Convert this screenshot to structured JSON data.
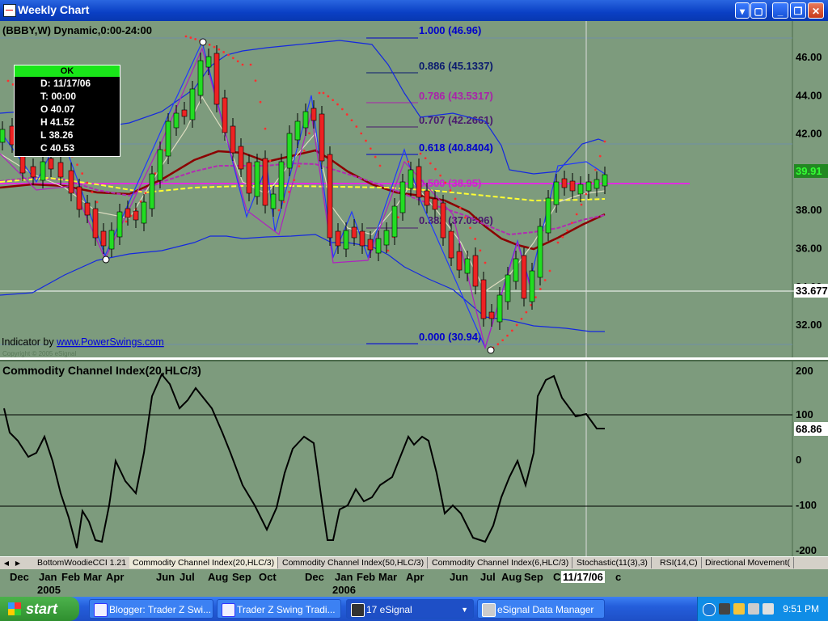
{
  "window": {
    "title": "Weekly Chart"
  },
  "chart": {
    "header": "(BBBY,W) Dynamic,0:00-24:00",
    "indicator_credit_prefix": "Indicator by ",
    "indicator_credit_link": "www.PowerSwings.com",
    "copyright": "Copyright © 2005 eSignal",
    "crosshair_price": "33.677",
    "last_price": "39.91",
    "price_ticks": [
      "46.00",
      "44.00",
      "42.00",
      "40.00",
      "38.00",
      "36.00",
      "34.00",
      "32.00"
    ],
    "fib_levels": [
      {
        "label": "1.000 (46.96)",
        "color": "#0000cc"
      },
      {
        "label": "0.886 (45.1337)",
        "color": "#0a1a6e"
      },
      {
        "label": "0.786 (43.5317)",
        "color": "#aa22aa"
      },
      {
        "label": "0.707 (42.2661)",
        "color": "#4a1a6e"
      },
      {
        "label": "0.618 (40.8404)",
        "color": "#0000cc"
      },
      {
        "label": "0.500 (38.95)",
        "color": "#cc22cc"
      },
      {
        "label": "0.382 (37.0596)",
        "color": "#4a1a6e"
      },
      {
        "label": "0.000 (30.94)",
        "color": "#0000cc"
      }
    ]
  },
  "ohlc": {
    "status": "OK",
    "date": "D: 11/17/06",
    "time": "T: 00:00",
    "open": "O 40.07",
    "high": "H 41.52",
    "low": "L 38.26",
    "close": "C 40.53"
  },
  "cci": {
    "title": "Commodity Channel Index(20,HLC/3)",
    "ticks": [
      "200",
      "100",
      "0",
      "-100",
      "-200"
    ],
    "current": "68.86"
  },
  "tabs": [
    "BottomWoodieCCI 1.21",
    "Commodity Channel Index(20,HLC/3)",
    "Commodity Channel Index(50,HLC/3)",
    "Commodity Channel Index(6,HLC/3)",
    "Stochastic(11(3),3)",
    "RSI(14,C)",
    "Directional Movement("
  ],
  "date_axis": {
    "months": [
      "Dec",
      "Jan",
      "Feb",
      "Mar",
      "Apr",
      "Jun",
      "Jul",
      "Aug",
      "Sep",
      "Oct",
      "Dec",
      "Jan",
      "Feb",
      "Mar",
      "Apr",
      "Jun",
      "Jul",
      "Aug",
      "Sep",
      "C",
      "c"
    ],
    "years": [
      "2005",
      "2006"
    ],
    "cursor_date": "11/17/06"
  },
  "taskbar": {
    "start": "start",
    "buttons": [
      "Blogger: Trader Z Swi...",
      "Trader Z Swing Tradi...",
      "17 eSignal",
      "eSignal Data Manager"
    ],
    "clock": "9:51 PM"
  }
}
